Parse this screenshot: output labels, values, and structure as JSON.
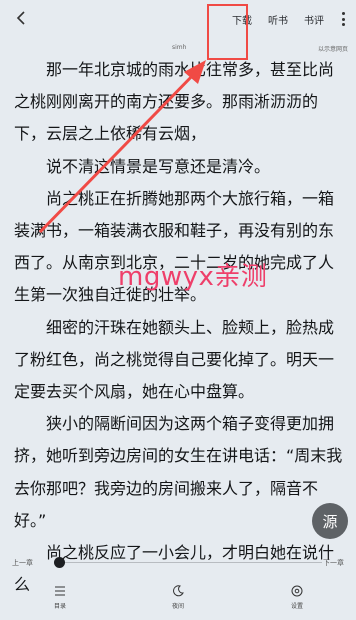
{
  "header": {
    "download_label": "下载",
    "listen_label": "听书",
    "review_label": "书评"
  },
  "meta": {
    "site": "simh",
    "note": "以示意网页"
  },
  "content": {
    "paragraphs": [
      "那一年北京城的雨水比往常多，甚至比尚之桃刚刚离开的南方还要多。那雨淅沥沥的下，云层之上依稀有云烟，",
      "说不清这情景是写意还是清冷。",
      "尚之桃正在折腾她那两个大旅行箱，一箱装满书，一箱装满衣服和鞋子，再没有别的东西了。从南京到北京，二十二岁的她完成了人生第一次独自迁徙的壮举。",
      "细密的汗珠在她额头上、脸颊上，脸热成了粉红色，尚之桃觉得自己要化掉了。明天一定要去买个风扇，她在心中盘算。",
      "狭小的隔断间因为这两个箱子变得更加拥挤，她听到旁边房间的女生在讲电话：“周末我去你那吧？我旁边的房间搬来人了，隔音不好。”",
      "尚之桃反应了一小会儿，才明白她在说什么"
    ]
  },
  "overlay": {
    "watermark": "mgwyx亲测",
    "fab_label": "源"
  },
  "progress": {
    "prev_label": "上一章",
    "next_label": "下一章",
    "value": 0.0
  },
  "bottom_nav": {
    "catalog_label": "目录",
    "night_label": "夜间",
    "settings_label": "设置"
  },
  "colors": {
    "background": "#e6ebf0",
    "annotation_red": "#f04a45",
    "watermark_pink": "#ee3f6a"
  }
}
